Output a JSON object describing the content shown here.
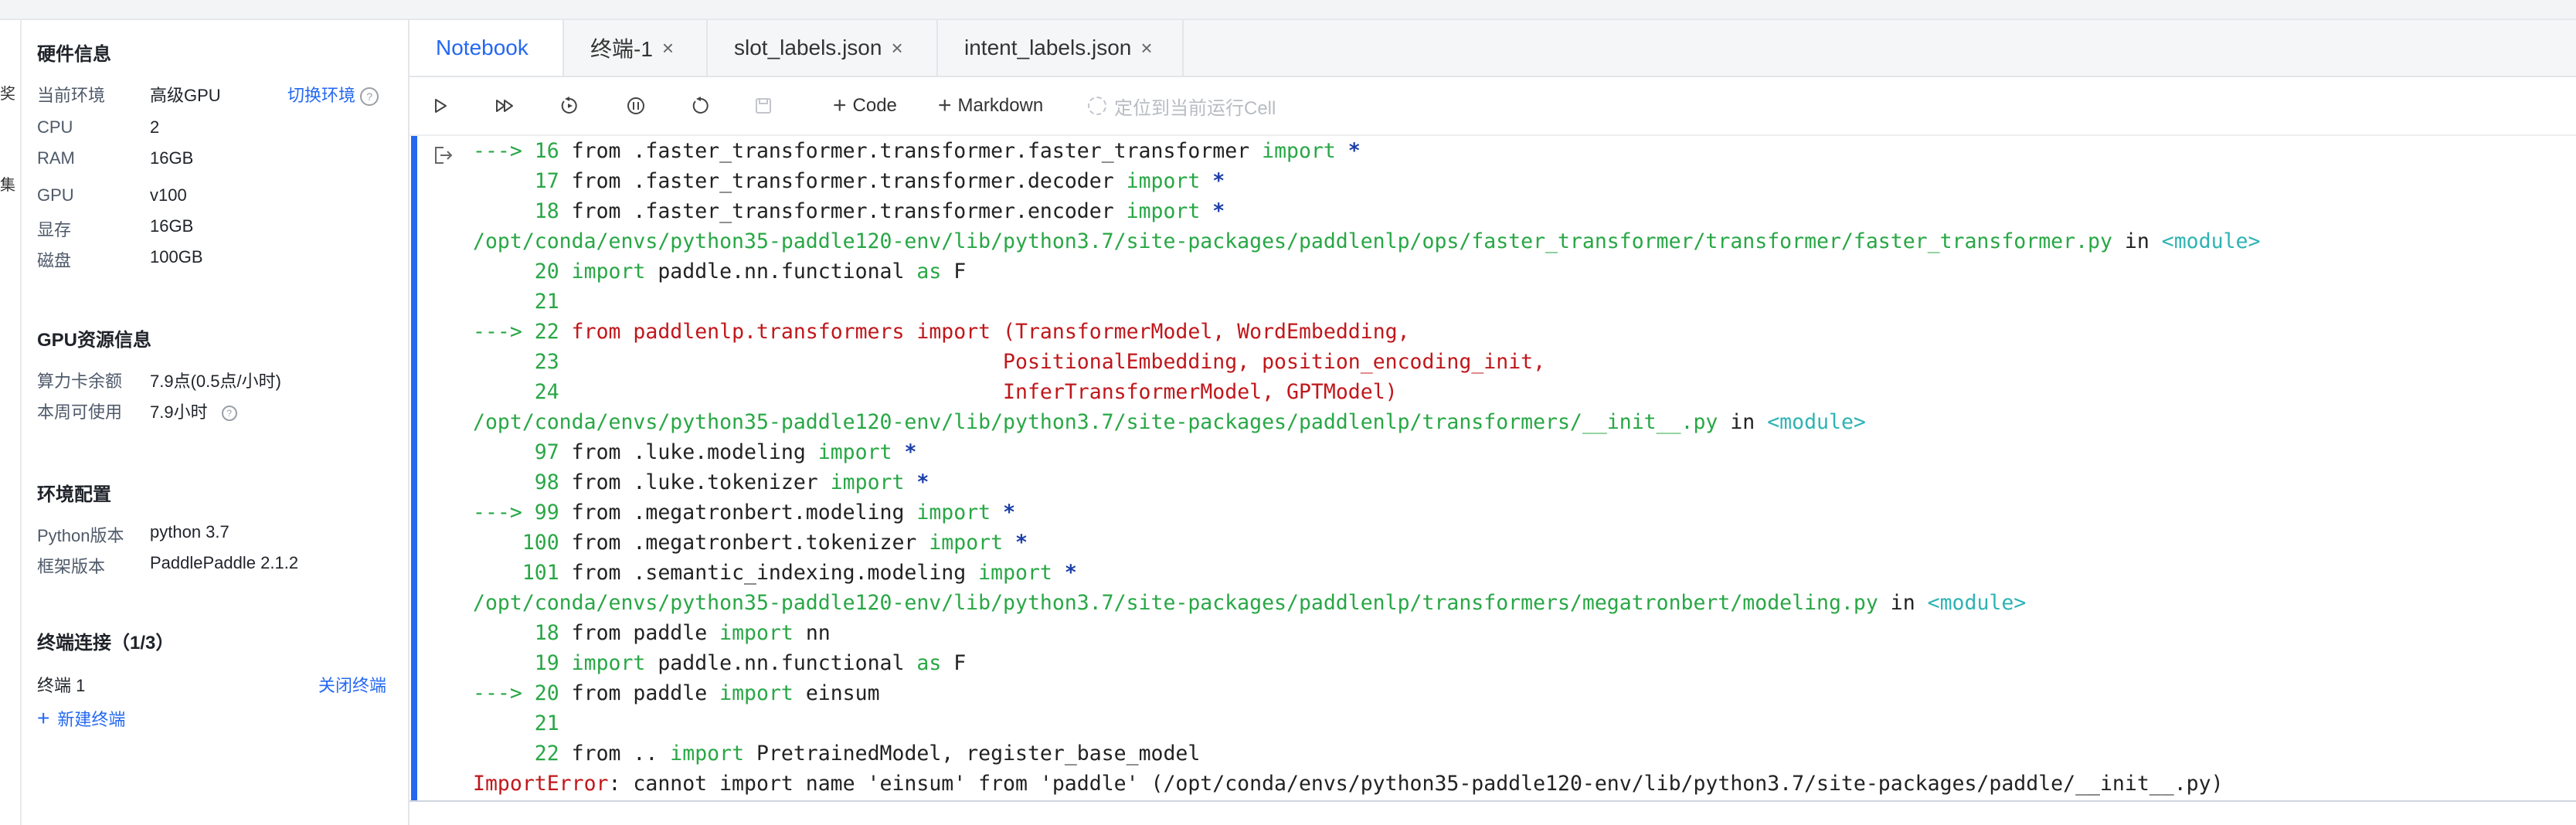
{
  "leftrail": {
    "glyph1": "奖",
    "glyph2": "集"
  },
  "hardware": {
    "title": "硬件信息",
    "env_label": "当前环境",
    "env_value": "高级GPU",
    "switch_link": "切换环境",
    "cpu_label": "CPU",
    "cpu_value": "2",
    "ram_label": "RAM",
    "ram_value": "16GB",
    "gpu_label": "GPU",
    "gpu_value": "v100",
    "vram_label": "显存",
    "vram_value": "16GB",
    "disk_label": "磁盘",
    "disk_value": "100GB"
  },
  "gpu_resource": {
    "title": "GPU资源信息",
    "balance_label": "算力卡余额",
    "balance_value": "7.9点(0.5点/小时)",
    "weekly_label": "本周可使用",
    "weekly_value": "7.9小时"
  },
  "env_config": {
    "title": "环境配置",
    "python_label": "Python版本",
    "python_value": "python 3.7",
    "framework_label": "框架版本",
    "framework_value": "PaddlePaddle 2.1.2"
  },
  "terminal": {
    "title": "终端连接（1/3）",
    "item_label": "终端 1",
    "close_link": "关闭终端",
    "new_link": "新建终端"
  },
  "tabs": [
    {
      "label": "Notebook",
      "closable": false,
      "active": true
    },
    {
      "label": "终端-1",
      "closable": true
    },
    {
      "label": "slot_labels.json",
      "closable": true
    },
    {
      "label": "intent_labels.json",
      "closable": true
    }
  ],
  "toolbar": {
    "code_label": "Code",
    "markdown_label": "Markdown",
    "locate_label": "定位到当前运行Cell"
  },
  "output": {
    "l1": {
      "arrow": "---> ",
      "num": "16",
      "text": " from .faster_transformer.transformer.faster_transformer ",
      "kw": "import",
      "tail": " *"
    },
    "l2": {
      "pad": "     ",
      "num": "17",
      "text": " from .faster_transformer.transformer.decoder ",
      "kw": "import",
      "tail": " *"
    },
    "l3": {
      "pad": "     ",
      "num": "18",
      "text": " from .faster_transformer.transformer.encoder ",
      "kw": "import",
      "tail": " *"
    },
    "l4": {
      "path": "/opt/conda/envs/python35-paddle120-env/lib/python3.7/site-packages/paddlenlp/ops/faster_transformer/transformer/faster_transformer.py",
      "in": " in ",
      "module": "<module>"
    },
    "l5": {
      "pad": "     ",
      "num": "20",
      "kw1": " import",
      "text": " paddle.nn.functional ",
      "kw2": "as",
      "tail": " F"
    },
    "l6": {
      "pad": "     ",
      "num": "21"
    },
    "l7": {
      "arrow": "---> ",
      "num": "22",
      "text": " from paddlenlp.transformers import (TransformerModel, WordEmbedding,"
    },
    "l8": {
      "pad": "     ",
      "num": "23",
      "text": "                                    PositionalEmbedding, position_encoding_init,"
    },
    "l9": {
      "pad": "     ",
      "num": "24",
      "text": "                                    InferTransformerModel, GPTModel)"
    },
    "l10": {
      "path": "/opt/conda/envs/python35-paddle120-env/lib/python3.7/site-packages/paddlenlp/transformers/__init__.py",
      "in": " in ",
      "module": "<module>"
    },
    "l11": {
      "pad": "     ",
      "num": "97",
      "text": " from .luke.modeling ",
      "kw": "import",
      "tail": " *"
    },
    "l12": {
      "pad": "     ",
      "num": "98",
      "text": " from .luke.tokenizer ",
      "kw": "import",
      "tail": " *"
    },
    "l13": {
      "arrow": "---> ",
      "num": "99",
      "text": " from .megatronbert.modeling ",
      "kw": "import",
      "tail": " *"
    },
    "l14": {
      "pad": "    ",
      "num": "100",
      "text": " from .megatronbert.tokenizer ",
      "kw": "import",
      "tail": " *"
    },
    "l15": {
      "pad": "    ",
      "num": "101",
      "text": " from .semantic_indexing.modeling ",
      "kw": "import",
      "tail": " *"
    },
    "l16": {
      "path": "/opt/conda/envs/python35-paddle120-env/lib/python3.7/site-packages/paddlenlp/transformers/megatronbert/modeling.py",
      "in": " in ",
      "module": "<module>"
    },
    "l17": {
      "pad": "     ",
      "num": "18",
      "text": " from paddle ",
      "kw": "import",
      "tail": " nn"
    },
    "l18": {
      "pad": "     ",
      "num": "19",
      "kw1": " import",
      "text": " paddle.nn.functional ",
      "kw2": "as",
      "tail": " F"
    },
    "l19": {
      "arrow": "---> ",
      "num": "20",
      "text": " from paddle ",
      "kw": "import",
      "tail": " einsum"
    },
    "l20": {
      "pad": "     ",
      "num": "21"
    },
    "l21": {
      "pad": "     ",
      "num": "22",
      "text": " from .. ",
      "kw": "import",
      "tail": " PretrainedModel, register_base_model"
    },
    "l22": {
      "err": "ImportError",
      "text": ": cannot import name 'einsum' from 'paddle' (/opt/conda/envs/python35-paddle120-env/lib/python3.7/site-packages/paddle/__init__.py)"
    }
  }
}
